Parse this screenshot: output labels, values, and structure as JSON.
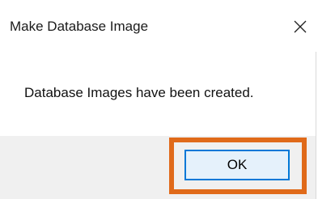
{
  "window": {
    "title": "Make Database Image",
    "close_icon": "close-icon"
  },
  "message": {
    "text": "Database Images have been created."
  },
  "buttons": {
    "ok_label": "OK"
  },
  "colors": {
    "highlight": "#e06a1a",
    "ok_border": "#0078d7",
    "ok_fill": "#e5f1fb",
    "footer": "#f0f0f0"
  }
}
